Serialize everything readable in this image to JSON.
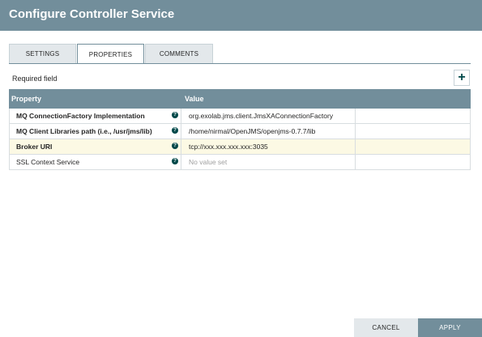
{
  "dialog": {
    "title": "Configure Controller Service"
  },
  "tabs": [
    {
      "label": "SETTINGS"
    },
    {
      "label": "PROPERTIES"
    },
    {
      "label": "COMMENTS"
    }
  ],
  "properties_tab": {
    "required_label": "Required field",
    "add_icon": "+",
    "columns": {
      "property": "Property",
      "value": "Value"
    },
    "help_icon": "?",
    "rows": [
      {
        "name": "MQ ConnectionFactory Implementation",
        "value": "org.exolab.jms.client.JmsXAConnectionFactory"
      },
      {
        "name": "MQ Client Libraries path (i.e., /usr/jms/lib)",
        "value": "/home/nirmal/OpenJMS/openjms-0.7.7/lib"
      },
      {
        "name": "Broker URI",
        "value": "tcp://xxx.xxx.xxx.xxx:3035"
      },
      {
        "name": "SSL Context Service",
        "value": "No value set"
      }
    ]
  },
  "footer": {
    "cancel_label": "CANCEL",
    "apply_label": "APPLY"
  },
  "colors": {
    "header": "#728e9b",
    "accent": "#004849",
    "highlight_row": "#fcf9e4"
  }
}
